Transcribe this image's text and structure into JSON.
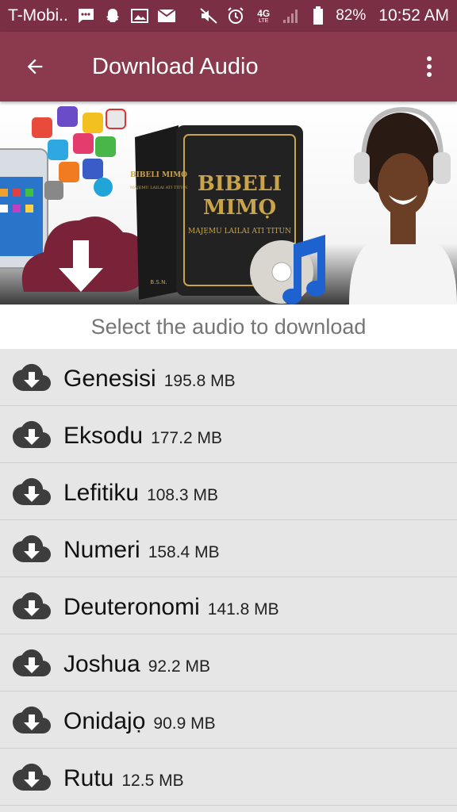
{
  "status_bar": {
    "carrier": "T-Mobi..",
    "network": "4G",
    "network_sub": "LTE",
    "battery": "82%",
    "time": "10:52 AM",
    "icons": [
      "message-icon",
      "snapchat-icon",
      "image-icon",
      "mail-icon",
      "mute-icon",
      "alarm-icon",
      "signal-icon",
      "battery-icon"
    ]
  },
  "app_bar": {
    "title": "Download Audio",
    "back_icon": "arrow-back-icon",
    "menu_icon": "more-vert-icon"
  },
  "banner": {
    "book_title_line1": "BIBELI",
    "book_title_line2": "MIMỌ",
    "book_subtitle": "MAJẸMU LAILAI ATI TITUN",
    "spine_text": "BIBELI MIMỌ",
    "spine_sub": "MAJẸMU LAILAI ATI TITUN",
    "spine_footer": "B.S.N."
  },
  "subtitle": "Select the audio to download",
  "colors": {
    "status_bar": "#7a2f44",
    "app_bar": "#8a3a4c",
    "list_bg": "#e6e6e6",
    "download_cloud": "#3d3d3d"
  },
  "items": [
    {
      "name": "Genesisi",
      "size": "195.8 MB"
    },
    {
      "name": "Eksodu",
      "size": "177.2 MB"
    },
    {
      "name": "Lefitiku",
      "size": "108.3 MB"
    },
    {
      "name": "Numeri",
      "size": "158.4 MB"
    },
    {
      "name": "Deuteronomi",
      "size": "141.8 MB"
    },
    {
      "name": "Joshua",
      "size": "92.2 MB"
    },
    {
      "name": "Onidajọ",
      "size": "90.9 MB"
    },
    {
      "name": "Rutu",
      "size": "12.5 MB"
    }
  ]
}
